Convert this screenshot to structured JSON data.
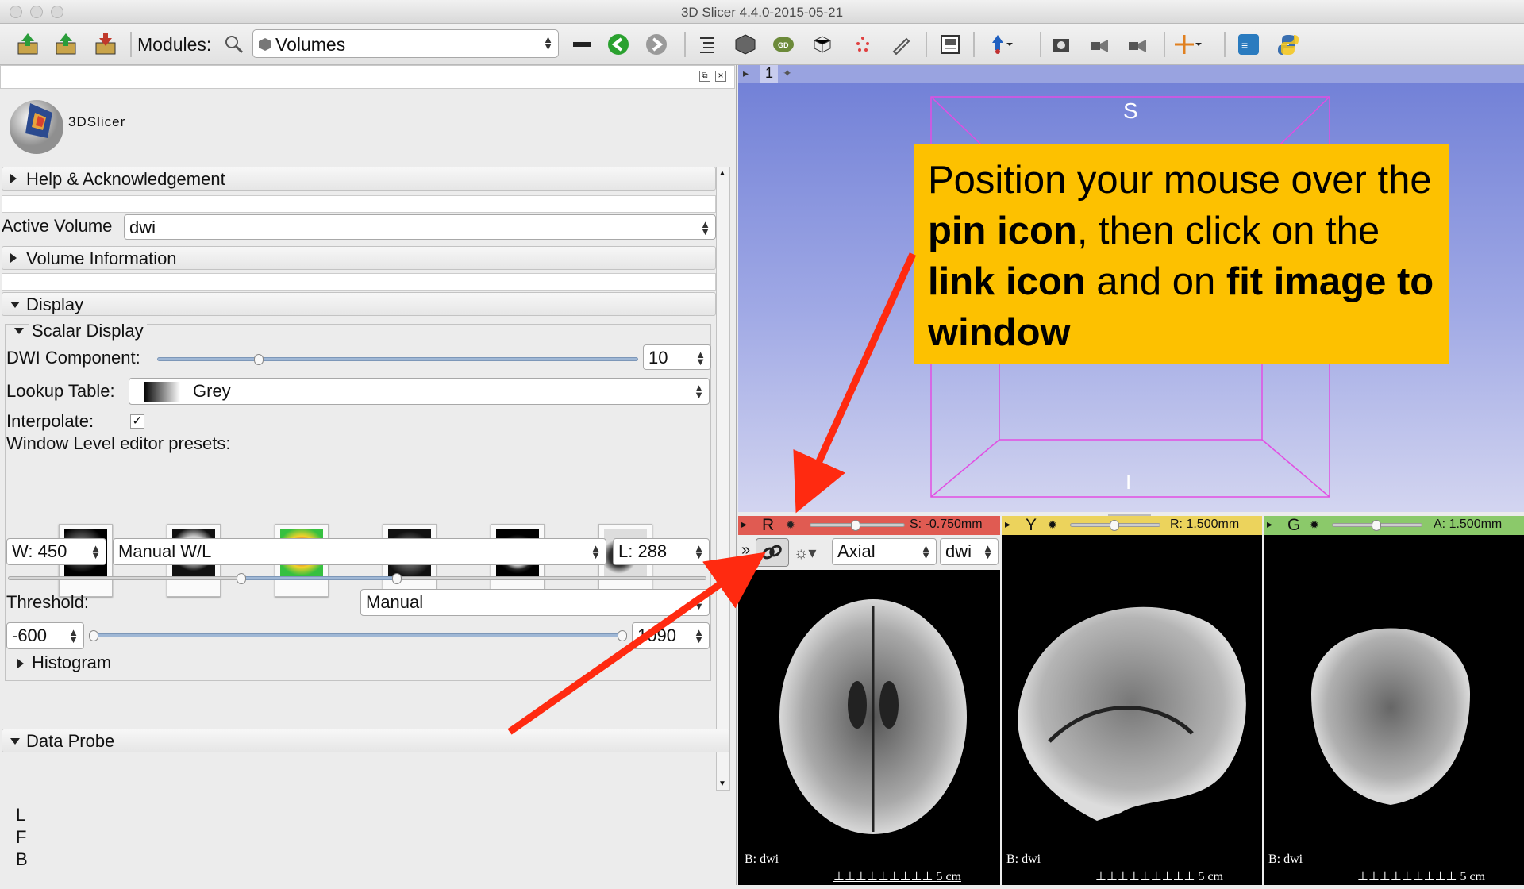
{
  "window": {
    "title": "3D Slicer 4.4.0-2015-05-21"
  },
  "toolbar": {
    "data_label": "DATA",
    "dcm_label": "DCM",
    "save_label": "SAVE",
    "modules_label": "Modules:",
    "module_selected": "Volumes"
  },
  "logo": {
    "text": "3DSlicer"
  },
  "panel": {
    "help_section": "Help & Acknowledgement",
    "active_volume_label": "Active Volume",
    "active_volume_value": "dwi",
    "volume_info_section": "Volume Information",
    "display_section": "Display",
    "scalar_display_section": "Scalar Display",
    "dwi_component_label": "DWI Component:",
    "dwi_component_value": "10",
    "lookup_table_label": "Lookup Table:",
    "lookup_table_value": "Grey",
    "interpolate_label": "Interpolate:",
    "interpolate_checked": true,
    "wl_presets_label": "Window Level editor presets:",
    "window_value": "W: 450",
    "wl_mode": "Manual W/L",
    "level_value": "L: 288",
    "threshold_label": "Threshold:",
    "threshold_mode": "Manual",
    "threshold_min": "-600",
    "threshold_max": "1090",
    "histogram_section": "Histogram",
    "data_probe_section": "Data Probe",
    "probe_lines": [
      "L",
      "F",
      "B"
    ]
  },
  "view3d": {
    "layout_label": "1",
    "orientation_label": "S",
    "bottom_marker": "I"
  },
  "slices": {
    "red": {
      "letter": "R",
      "offset": "S: -0.750mm",
      "orientation": "Axial",
      "volume": "dwi",
      "background": "B: dwi",
      "scale": "5 cm",
      "more": "»"
    },
    "yellow": {
      "letter": "Y",
      "offset": "R: 1.500mm",
      "background": "B: dwi",
      "scale": "5 cm"
    },
    "green": {
      "letter": "G",
      "offset": "A: 1.500mm",
      "background": "B: dwi",
      "scale": "5 cm"
    }
  },
  "callout": {
    "t1": "Position your mouse over the ",
    "b1": "pin icon",
    "t2": ", then click on the ",
    "b2": "link icon",
    "t3": " and on ",
    "b3": "fit image to window"
  },
  "colors": {
    "callout_bg": "#fdc100",
    "arrow": "#ff2a10",
    "red_bar": "#e05b52",
    "yellow_bar": "#ecd35c",
    "green_bar": "#8bc96a"
  }
}
